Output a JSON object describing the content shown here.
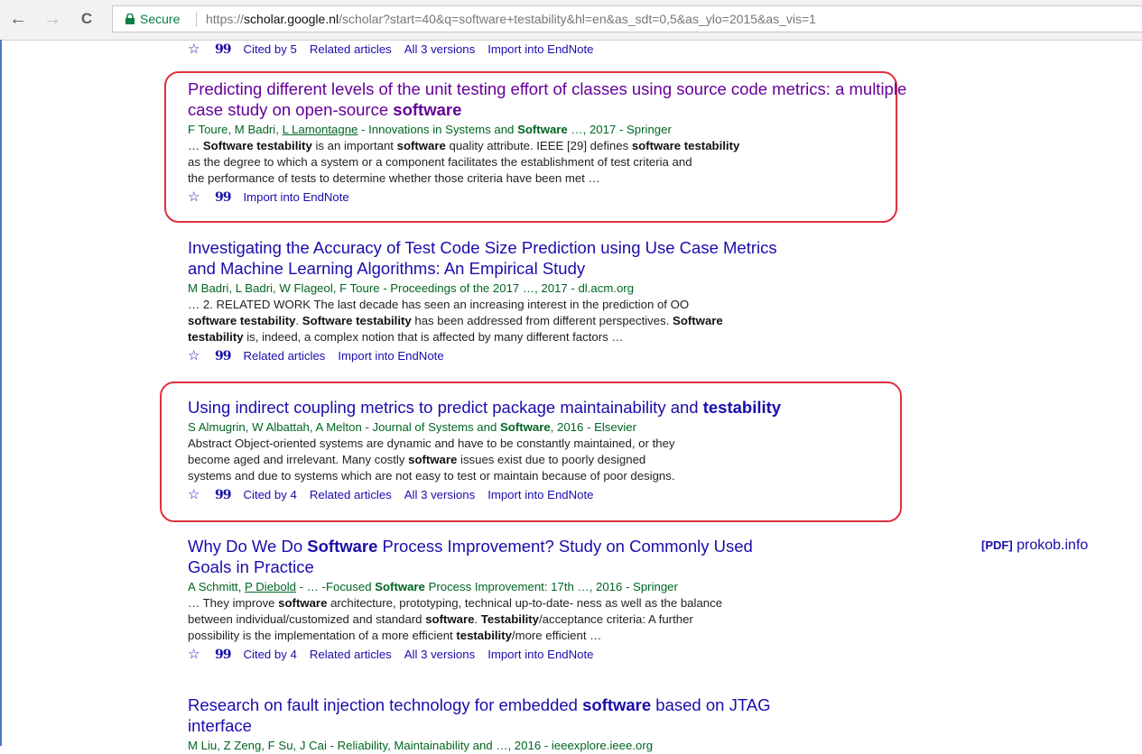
{
  "browser": {
    "secure_label": "Secure",
    "url_scheme": "https://",
    "url_host": "scholar.google.nl",
    "url_path": "/scholar?start=40&q=software+testability&hl=en&as_sdt=0,5&as_ylo=2015&as_vis=1"
  },
  "icons": {
    "back": "←",
    "forward": "→",
    "reload": "C",
    "star": "☆",
    "cite": "99"
  },
  "top_actions": {
    "cited_by": "Cited by 5",
    "related": "Related articles",
    "versions": "All 3 versions",
    "import": "Import into EndNote"
  },
  "results": [
    {
      "title_pre": "Predicting different levels of the unit testing effort of classes using source code metrics: a multiple case study on open-source ",
      "title_bold": "software",
      "meta_a": "F Toure, M Badri, ",
      "meta_link": "L Lamontagne",
      "meta_b": " - Innovations in Systems and ",
      "meta_bold": "Software",
      "meta_c": " …, 2017 - Springer",
      "snippet": [
        [
          "… ",
          "Software testability",
          " is an important ",
          "software",
          " quality attribute. IEEE [29] defines ",
          "software testability"
        ],
        [
          "as the degree to which a system or a component facilitates the establishment of test criteria and"
        ],
        [
          "the performance of tests to determine whether those criteria have been met …"
        ]
      ],
      "actions": [
        "Import into EndNote"
      ]
    },
    {
      "title_line1": "Investigating the Accuracy of Test Code Size Prediction using Use Case Metrics",
      "title_line2": "and Machine Learning Algorithms: An Empirical Study",
      "meta": "M Badri, L Badri, W Flageol, F Toure - Proceedings of the 2017 …, 2017 - dl.acm.org",
      "snippet": [
        [
          "… 2. RELATED WORK The last decade has seen an increasing interest in the prediction of OO"
        ],
        [
          "",
          "software testability",
          ". ",
          "Software testability",
          " has been addressed from different perspectives. ",
          "Software"
        ],
        [
          "",
          "testability",
          " is, indeed, a complex notion that is affected by many different factors …"
        ]
      ],
      "actions": [
        "Related articles",
        "Import into EndNote"
      ]
    },
    {
      "title_pre": "Using indirect coupling metrics to predict package maintainability and ",
      "title_bold": "testability",
      "meta_a": "S Almugrin, W Albattah, A Melton - Journal of Systems and ",
      "meta_bold": "Software",
      "meta_c": ", 2016 - Elsevier",
      "snippet": [
        [
          "Abstract Object-oriented systems are dynamic and have to be constantly maintained, or they"
        ],
        [
          "become aged and irrelevant. Many costly ",
          "software",
          " issues exist due to poorly designed"
        ],
        [
          "systems and due to systems which are not easy to test or maintain because of poor designs."
        ]
      ],
      "actions": [
        "Cited by 4",
        "Related articles",
        "All 3 versions",
        "Import into EndNote"
      ]
    },
    {
      "title_a": "Why Do We Do ",
      "title_bold": "Software",
      "title_b": " Process Improvement? Study on Commonly Used",
      "title_line2": "Goals in Practice",
      "meta_a": "A Schmitt, ",
      "meta_link": "P Diebold",
      "meta_b": " - … -Focused ",
      "meta_bold": "Software",
      "meta_c": " Process Improvement: 17th …, 2016 - Springer",
      "snippet": [
        [
          "… They improve ",
          "software",
          " architecture, prototyping, technical up-to-date- ness as well as the balance"
        ],
        [
          "between individual/customized and standard ",
          "software",
          ". ",
          "Testability",
          "/acceptance criteria: A further"
        ],
        [
          "possibility is the implementation of a more efficient ",
          "testability",
          "/more efficient …"
        ]
      ],
      "actions": [
        "Cited by 4",
        "Related articles",
        "All 3 versions",
        "Import into EndNote"
      ],
      "pdf_tag": "[PDF]",
      "pdf_source": "prokob.info"
    },
    {
      "title_a": "Research on fault injection technology for embedded ",
      "title_bold": "software",
      "title_b": " based on JTAG",
      "title_line2": "interface",
      "meta": "M Liu, Z Zeng, F Su, J Cai - Reliability, Maintainability and …, 2016 - ieeexplore.ieee.org"
    }
  ]
}
